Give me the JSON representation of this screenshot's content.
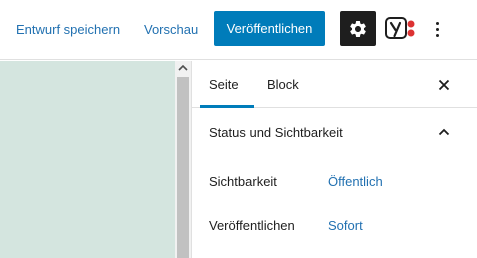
{
  "toolbar": {
    "save_draft_label": "Entwurf speichern",
    "preview_label": "Vorschau",
    "publish_label": "Veröffentlichen",
    "settings_icon": "gear-icon",
    "yoast_icon": "yoast-icon",
    "more_icon": "more-vertical-icon"
  },
  "sidebar": {
    "tabs": [
      {
        "label": "Seite",
        "active": true
      },
      {
        "label": "Block",
        "active": false
      }
    ],
    "close_icon": "close-icon",
    "panel": {
      "title": "Status und Sichtbarkeit",
      "expanded": true,
      "rows": [
        {
          "label": "Sichtbarkeit",
          "value": "Öffentlich"
        },
        {
          "label": "Veröffentlichen",
          "value": "Sofort"
        }
      ]
    }
  },
  "colors": {
    "accent": "#007cba",
    "link": "#2271b1",
    "canvas": "#d4e5df",
    "dark": "#1e1e1e",
    "yoast_red": "#dc3232"
  }
}
